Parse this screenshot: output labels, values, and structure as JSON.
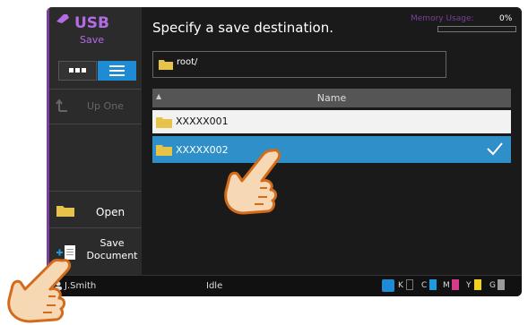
{
  "sidebar": {
    "usb_title": "USB",
    "usb_subtitle": "Save",
    "up_one_label": "Up One",
    "open_label": "Open",
    "save_document_label_line1": "Save",
    "save_document_label_line2": "Document"
  },
  "main": {
    "prompt": "Specify a save destination.",
    "memory_label": "Memory Usage:",
    "memory_value": "0%",
    "path": "root/",
    "column_name": "Name",
    "rows": [
      {
        "name": "XXXXX001",
        "selected": false
      },
      {
        "name": "XXXXX002",
        "selected": true
      }
    ]
  },
  "status": {
    "user": "J.Smith",
    "state": "Idle",
    "toner": [
      {
        "label": "K",
        "color": "#222222"
      },
      {
        "label": "C",
        "color": "#1d9be0"
      },
      {
        "label": "M",
        "color": "#d63a8a"
      },
      {
        "label": "Y",
        "color": "#f2d21b"
      },
      {
        "label": "G",
        "color": "#999999"
      }
    ]
  },
  "colors": {
    "accent_blue": "#1d8cd4",
    "accent_purple": "#7a3f9a",
    "selected_row": "#2f8fc9"
  }
}
